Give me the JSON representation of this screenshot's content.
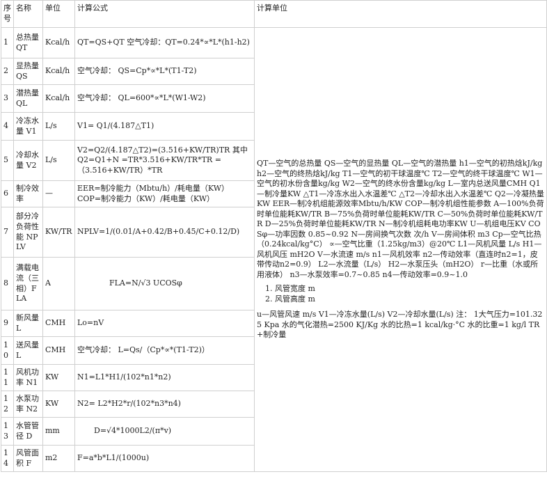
{
  "headers": {
    "index": "序号",
    "name": "名称",
    "unit": "单位",
    "formula": "计算公式",
    "calc_units": "计算单位"
  },
  "rows": [
    {
      "index": "1",
      "name": "总热量 QT",
      "unit": "Kcal/h",
      "formula": "QT=QS+QT 空气冷却：QT=0.24*∝*L*(h1-h2)"
    },
    {
      "index": "2",
      "name": "显热量 QS",
      "unit": "Kcal/h",
      "formula": "空气冷却：  QS=Cp*∝*L*(T1-T2)"
    },
    {
      "index": "3",
      "name": "潜热量 QL",
      "unit": "Kcal/h",
      "formula": "空气冷却：  QL=600*∝*L*(W1-W2)"
    },
    {
      "index": "4",
      "name": "冷冻水量 V1",
      "unit": "L/s",
      "formula": "V1= Q1/(4.187△T1)"
    },
    {
      "index": "5",
      "name": "冷却水量 V2",
      "unit": "L/s",
      "formula": "V2=Q2/(4.187△T2)=(3.516+KW/TR)TR 其中 Q2=Q1+N =TR*3.516+KW/TR*TR =\n（3.516+KW/TR）*TR"
    },
    {
      "index": "6",
      "name": "制冷效率",
      "unit": "—",
      "formula": "EER=制冷能力（Mbtu/h）/耗电量（KW）\nCOP=制冷能力（KW）/耗电量（KW）"
    },
    {
      "index": "7",
      "name": "部分冷负荷性能 NPLV",
      "unit": "KW/TR",
      "formula": "NPLV=1/(0.01/A+0.42/B+0.45/C+0.12/D)"
    },
    {
      "index": "8",
      "name": "满载电流（三相）FLA",
      "unit": "A",
      "formula": "FLA=N/√3 UCOSφ"
    },
    {
      "index": "9",
      "name": "新风量 L",
      "unit": "CMH",
      "formula": "Lo=nV"
    },
    {
      "index": "10",
      "name": "送风量 L",
      "unit": "CMH",
      "formula": "空气冷却：  L=Qs/（Cp*∝*(T1-T2)）"
    },
    {
      "index": "11",
      "name": "风机功率 N1",
      "unit": "KW",
      "formula": "N1=L1*H1/(102*n1*n2)"
    },
    {
      "index": "12",
      "name": "水泵功率 N2",
      "unit": "KW",
      "formula": "N2= L2*H2*r/(102*n3*n4)"
    },
    {
      "index": "13",
      "name": "水管管径 D",
      "unit": "mm",
      "formula": "D=√4*1000L2/(π*v)"
    },
    {
      "index": "14",
      "name": "风管面积 F",
      "unit": "m2",
      "formula": "F=a*b*L1/(1000u)"
    }
  ],
  "calc_units_text": {
    "definitions": "QT—空气的总热量 QS—空气的显热量 QL—空气的潜热量 h1—空气的初热焓kJ/kg h2—空气的终热焓kJ/kg T1—空气的初干球温度℃ T2—空气的终干球温度℃ W1—空气的初水份含量kg/kg W2—空气的终水份含量kg/kg L—室内总送风量CMH Q1—制冷量KW △T1—冷冻水出入水温差℃ △T2—冷却水出入水温差℃ Q2—冷凝热量KW EER—制冷机组能源效率Mbtu/h/KW COP—制冷机组性能参数 A—100%负荷时单位能耗KW/TR B—75%负荷时单位能耗KW/TR C—50%负荷时单位能耗KW/TR D—25%负荷时单位能耗KW/TR N—制冷机组耗电功率KW U—机组电压KV COSφ—功率因数 0.85~0.92 N—房间换气次数 次/h V—房间体积  m3 Cp—空气比热（0.24kcal/kg°C） ∝—空气比重（1.25kg/m3）@20℃ L1—风机风量  L/s H1—风机风压  mH2O V—水流速 m/s n1—风机效率 n2—传动效率（直连时n2=1，皮带传动n2=0.9） L2—水流量（L/s）  H2—水泵压头（mH2O） r—比重（水或所用液体） n3—水泵效率=0.7~0.85 n4—传动效率=0.9~1.0",
    "list_items": [
      "风管宽度  m",
      "风管高度  m"
    ],
    "notes": "u—风管风速  m/s V1—冷冻水量(L/s) V2—冷却水量(L/s) 注： 1大气压力=101.325 Kpa 水的气化潜热=2500 KJ/Kg 水的比热=1 kcal/kg·°C 水的比重=1 kg/l TR+制冷量"
  }
}
